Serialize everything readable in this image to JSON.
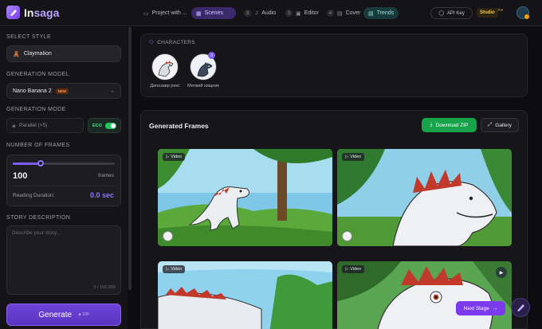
{
  "app": {
    "brand_a": "In",
    "brand_b": "saga"
  },
  "nav": {
    "project": "Project with ...",
    "tabs": [
      {
        "num": "",
        "label": "Scenes",
        "icon": "grid-icon"
      },
      {
        "num": "3",
        "label": "Audio",
        "icon": "headphones-icon"
      },
      {
        "num": "3",
        "label": "Editor",
        "icon": "film-icon"
      },
      {
        "num": "4",
        "label": "Cover",
        "icon": "image-icon"
      },
      {
        "num": "",
        "label": "Trends",
        "icon": "trend-icon"
      }
    ],
    "api_key": "API Key",
    "studio": "Studio",
    "credits": "∞"
  },
  "sidebar": {
    "style_label": "SELECT STYLE",
    "style_value": "Claymation",
    "model_label": "GENERATION MODEL",
    "model_value": "Nano Banana 2",
    "model_badge": "NEW",
    "mode_label": "GENERATION MODE",
    "mode_value": "Parallel (×5)",
    "eco_label": "ECO",
    "eco_on": true,
    "frames_label": "NUMBER OF FRAMES",
    "frames_value": "100",
    "frames_unit": "frames",
    "frames_slider": 0.27,
    "reading_label": "Reading Duration:",
    "reading_value": "0.0 sec",
    "story_label": "STORY DESCRIPTION",
    "story_placeholder": "Describe your story...",
    "story_counter": "0 / 100,000",
    "generate_label": "Generate",
    "generate_cost": "100"
  },
  "characters": {
    "title": "CHARACTERS",
    "items": [
      {
        "name": "Динозавр рекс",
        "count": ""
      },
      {
        "name": "Мелкий хищник",
        "count": "3"
      }
    ]
  },
  "frames": {
    "title": "Generated Frames",
    "download": "Download ZIP",
    "gallery": "Gallery",
    "tag": "Video"
  },
  "footer": {
    "next_stage": "Next Stage"
  },
  "colors": {
    "accent": "#7c3aed",
    "green": "#16a34a",
    "gold": "#f2c84b"
  }
}
